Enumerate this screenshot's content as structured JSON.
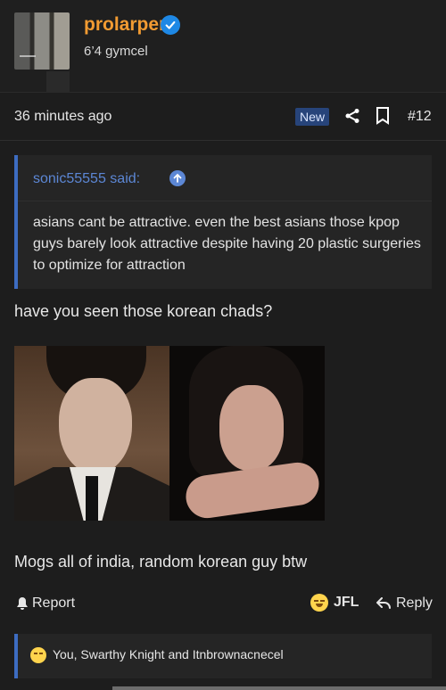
{
  "user": {
    "name": "prolarper",
    "title": "6’4 gymcel"
  },
  "post": {
    "time": "36 minutes ago",
    "badge": "New",
    "number": "#12",
    "quote": {
      "author": "sonic55555 said:",
      "text": "asians cant be attractive. even the best asians those kpop guys barely look attractive despite having 20 plastic surgeries to optimize for attraction"
    },
    "body_1": "have you seen those korean chads?",
    "body_2": "Mogs all of india, random korean guy btw"
  },
  "actions": {
    "report": "Report",
    "reaction": "JFL",
    "reply": "Reply"
  },
  "reactions": {
    "text": "You, Swarthy Knight and Itnbrownacnecel"
  },
  "colors": {
    "accent": "#f29b32",
    "blue": "#3d6cc1",
    "background": "#1d1d1d"
  }
}
